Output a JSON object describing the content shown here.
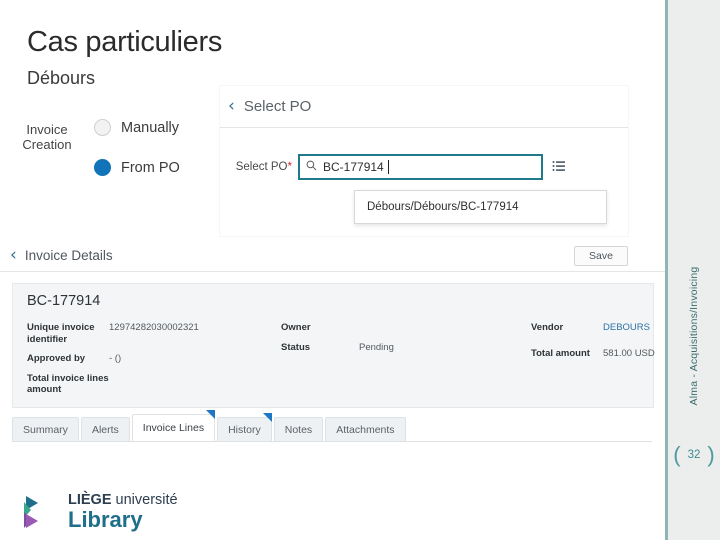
{
  "slide": {
    "title": "Cas particuliers",
    "subtitle": "Débours"
  },
  "rail": {
    "label": "Alma - Acquisitions/Invoicing",
    "page_number": "32",
    "bracket_left": "(",
    "bracket_right": ")",
    "accent_color": "#3d8c8c"
  },
  "invoice_creation": {
    "label": "Invoice\nCreation",
    "label_line1": "Invoice",
    "label_line2": "Creation",
    "options": [
      {
        "label": "Manually",
        "selected": false
      },
      {
        "label": "From PO",
        "selected": true
      }
    ],
    "selected_color": "#1274b8"
  },
  "select_po_panel": {
    "back_icon": "chevron-left-icon",
    "back_glyph": "‹",
    "title": "Select PO",
    "field_label": "Select PO",
    "required_marker": "*",
    "search_icon": "search-icon",
    "search_glyph": "⌕",
    "search_value": "BC-177914",
    "search_placeholder": "",
    "list_icon": "list-view-icon",
    "list_glyph": "≡",
    "suggestions": [
      "Débours/Débours/BC-177914"
    ]
  },
  "invoice_details_panel": {
    "back_icon": "chevron-left-icon",
    "back_glyph": "‹",
    "title": "Invoice Details",
    "save_label": "Save",
    "card": {
      "heading": "BC-177914",
      "fields_col1": [
        {
          "key": "Unique invoice identifier",
          "value": "12974282030002321"
        },
        {
          "key": "Approved by",
          "value": "- ()"
        },
        {
          "key": "Total invoice lines amount",
          "value": ""
        }
      ],
      "fields_col2": [
        {
          "key": "Owner",
          "value": ""
        },
        {
          "key": "Status",
          "value": "Pending"
        }
      ],
      "fields_col3": [
        {
          "key": "Vendor",
          "value": "DEBOURS",
          "is_link": true
        },
        {
          "key": "Total amount",
          "value": "581.00 USD",
          "is_link": false
        }
      ]
    },
    "tabs": [
      {
        "label": "Summary",
        "active": false,
        "corner": false
      },
      {
        "label": "Alerts",
        "active": false,
        "corner": false
      },
      {
        "label": "Invoice Lines",
        "active": true,
        "corner": true
      },
      {
        "label": "History",
        "active": false,
        "corner": true
      },
      {
        "label": "Notes",
        "active": false,
        "corner": false
      },
      {
        "label": "Attachments",
        "active": false,
        "corner": false
      }
    ]
  },
  "logo": {
    "line1_bold": "LIÈGE",
    "line1_rest": " université",
    "line2": "Library"
  }
}
